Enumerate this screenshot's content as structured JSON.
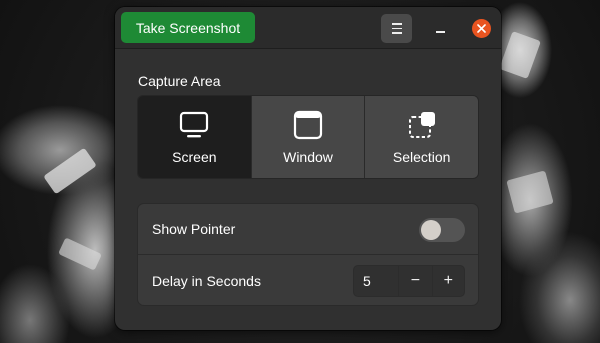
{
  "header": {
    "take_button_label": "Take Screenshot",
    "menu_icon": "hamburger-icon",
    "minimize_icon": "minimize-icon",
    "close_icon": "close-icon"
  },
  "capture_area": {
    "label": "Capture Area",
    "options": [
      {
        "label": "Screen",
        "icon": "monitor-icon",
        "selected": true
      },
      {
        "label": "Window",
        "icon": "window-icon",
        "selected": false
      },
      {
        "label": "Selection",
        "icon": "selection-icon",
        "selected": false
      }
    ]
  },
  "settings": {
    "show_pointer_label": "Show Pointer",
    "show_pointer_enabled": false,
    "delay_label": "Delay in Seconds",
    "delay_value": "5",
    "decrement_symbol": "−",
    "increment_symbol": "+"
  },
  "colors": {
    "accent_green": "#1e8a35",
    "close_orange": "#e95420",
    "window_bg": "#303030"
  }
}
